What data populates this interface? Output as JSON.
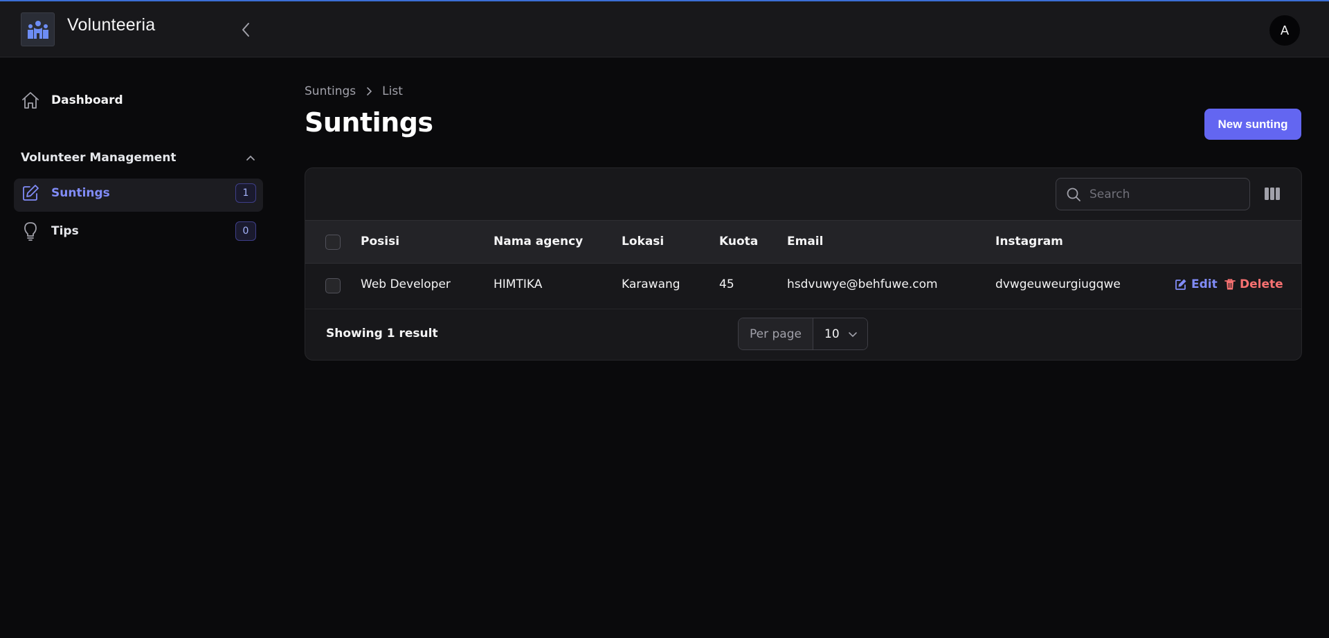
{
  "app": {
    "title": "Volunteeria",
    "avatar_initial": "A",
    "accent": "#6366f1"
  },
  "sidebar": {
    "dashboard_label": "Dashboard",
    "group_label": "Volunteer Management",
    "items": [
      {
        "label": "Suntings",
        "count": "1",
        "active": true
      },
      {
        "label": "Tips",
        "count": "0",
        "active": false
      }
    ]
  },
  "breadcrumb": {
    "parent": "Suntings",
    "current": "List"
  },
  "page": {
    "title": "Suntings",
    "new_button": "New sunting"
  },
  "table": {
    "search_placeholder": "Search",
    "columns": [
      "Posisi",
      "Nama agency",
      "Lokasi",
      "Kuota",
      "Email",
      "Instagram"
    ],
    "rows": [
      {
        "posisi": "Web Developer",
        "nama_agency": "HIMTIKA",
        "lokasi": "Karawang",
        "kuota": "45",
        "email": "hsdvuwye@behfuwe.com",
        "instagram": "dvwgeuweurgiugqwe",
        "edit_label": "Edit",
        "delete_label": "Delete"
      }
    ],
    "showing_text": "Showing 1 result",
    "per_page_label": "Per page",
    "per_page_value": "10"
  }
}
